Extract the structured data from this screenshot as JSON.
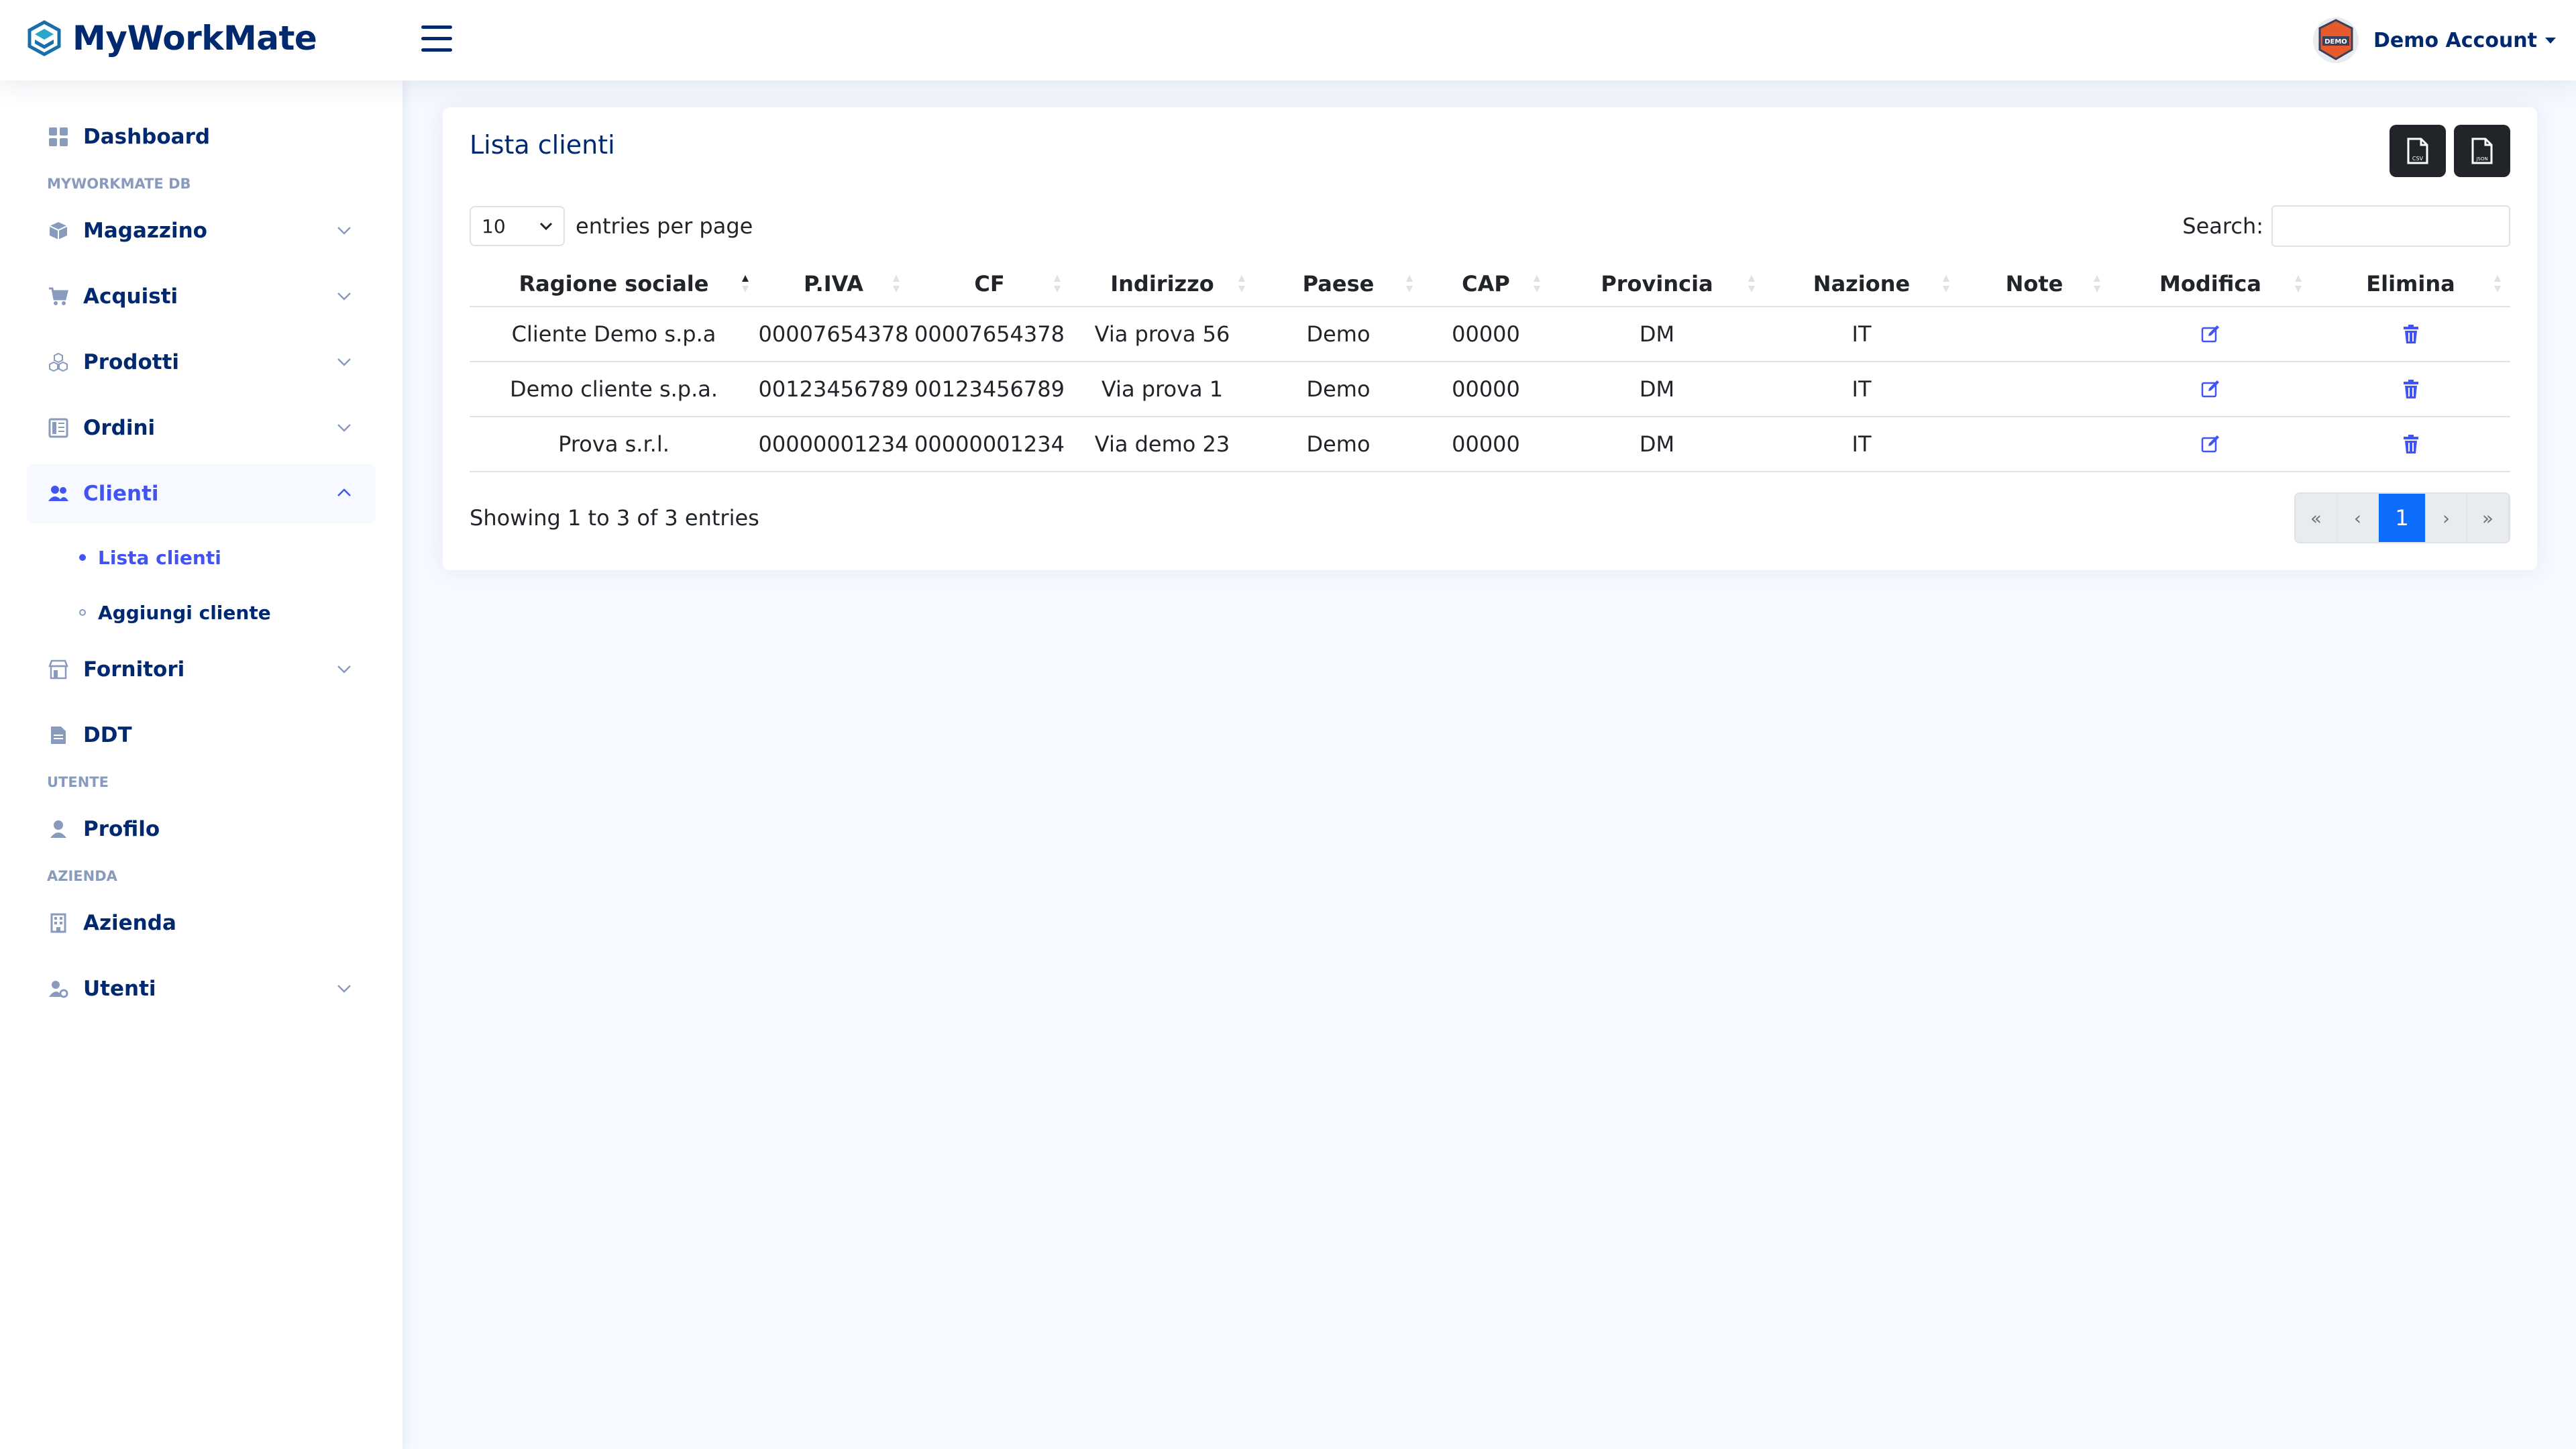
{
  "app": {
    "name": "MyWorkMate"
  },
  "header": {
    "account_name": "Demo Account"
  },
  "sidebar": {
    "items": [
      {
        "label": "Dashboard"
      },
      {
        "label": "Magazzino"
      },
      {
        "label": "Acquisti"
      },
      {
        "label": "Prodotti"
      },
      {
        "label": "Ordini"
      },
      {
        "label": "Clienti"
      },
      {
        "label": "Fornitori"
      },
      {
        "label": "DDT"
      },
      {
        "label": "Profilo"
      },
      {
        "label": "Azienda"
      },
      {
        "label": "Utenti"
      }
    ],
    "headings": [
      "MYWORKMATE DB",
      "UTENTE",
      "AZIENDA"
    ],
    "clienti_sub": [
      {
        "label": "Lista clienti"
      },
      {
        "label": "Aggiungi cliente"
      }
    ]
  },
  "card": {
    "title": "Lista clienti",
    "per_page": "10",
    "entries_label": "entries per page",
    "search_label": "Search:",
    "search_value": "",
    "info": "Showing 1 to 3 of 3 entries",
    "export_icons": [
      "csv-file-icon",
      "json-file-icon"
    ]
  },
  "table": {
    "headers": [
      "Ragione sociale",
      "P.IVA",
      "CF",
      "Indirizzo",
      "Paese",
      "CAP",
      "Provincia",
      "Nazione",
      "Note",
      "Modifica",
      "Elimina"
    ],
    "rows": [
      [
        "Cliente Demo s.p.a",
        "00007654378",
        "00007654378",
        "Via prova 56",
        "Demo",
        "00000",
        "DM",
        "IT",
        ""
      ],
      [
        "Demo cliente s.p.a.",
        "00123456789",
        "00123456789",
        "Via prova 1",
        "Demo",
        "00000",
        "DM",
        "IT",
        ""
      ],
      [
        "Prova s.r.l.",
        "00000001234",
        "00000001234",
        "Via demo 23",
        "Demo",
        "00000",
        "DM",
        "IT",
        ""
      ]
    ]
  },
  "pagination": {
    "first": "«",
    "prev": "‹",
    "current": "1",
    "next": "›",
    "last": "»"
  },
  "colors": {
    "primary": "#012970",
    "accent": "#4154f1",
    "page_active": "#0d6efd",
    "background": "#f6f9ff"
  }
}
